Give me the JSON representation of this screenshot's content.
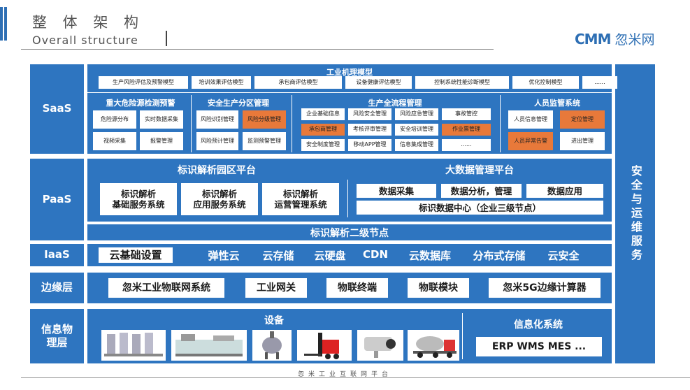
{
  "header": {
    "title_cn": "整 体 架 构",
    "title_en": "Overall structure",
    "logo_mark": "CMM",
    "logo_text": "忽米网"
  },
  "layers": {
    "saas": "SaaS",
    "paas": "PaaS",
    "iaas": "IaaS",
    "edge": "边缘层",
    "physical": "信息物理层",
    "security": "安全与运维服务"
  },
  "saas": {
    "industrial_model": {
      "title": "工业机理模型",
      "items": [
        "生产风险评估及预警模型",
        "培训效果评估模型",
        "承包商评估模型",
        "设备健康评估模型",
        "控制系统性能诊断模型",
        "优化控制模型",
        "......"
      ]
    },
    "hazard": {
      "title": "重大危险源检测预警",
      "items": [
        "危险源分布",
        "实时数据采集",
        "视频采集",
        "报警管理"
      ]
    },
    "zone": {
      "title": "安全生产分区管理",
      "items": [
        "风险识别管理",
        "风险分级管理",
        "风险预计管理",
        "监测预警管理"
      ]
    },
    "process": {
      "title": "生产全流程管理",
      "items": [
        "企业基础信息",
        "风险安全管理",
        "风险应急管理",
        "事故管控",
        "承包商管理",
        "考核评审管理",
        "安全培训管理",
        "作业票管理",
        "安全制度管理",
        "移动APP管理",
        "信息集成管理",
        "......"
      ]
    },
    "personnel": {
      "title": "人员监管系统",
      "items": [
        "人员信息管理",
        "定位管理",
        "人员异常告警",
        "进出管理"
      ]
    }
  },
  "paas": {
    "park": {
      "title": "标识解析园区平台",
      "items": [
        "标识解析\n基础服务系统",
        "标识解析\n应用服务系统",
        "标识解析\n运营管理系统"
      ]
    },
    "bigdata": {
      "title": "大数据管理平台",
      "items": [
        "数据采集",
        "数据分析，管理",
        "数据应用"
      ],
      "center": "标识数据中心（企业三级节点）"
    },
    "secondary": "标识解析二级节点"
  },
  "iaas": {
    "items": [
      "云基础设置",
      "弹性云",
      "云存储",
      "云硬盘",
      "CDN",
      "云数据库",
      "分布式存储",
      "云安全"
    ]
  },
  "edge": {
    "items": [
      "忽米工业物联网系统",
      "工业网关",
      "物联终端",
      "物联模块",
      "忽米5G边缘计算器"
    ]
  },
  "physical": {
    "device_title": "设备",
    "info_title": "信息化系统",
    "info_items": "ERP  WMS  MES ...",
    "devices": [
      "reactor-tanks",
      "packaging-machine",
      "mixer-vessel",
      "forklift",
      "security-camera",
      "mixer-truck"
    ]
  },
  "footer": "忽米工业互联网平台",
  "colors": {
    "primary": "#2e75c0",
    "highlight": "#e8793a"
  }
}
